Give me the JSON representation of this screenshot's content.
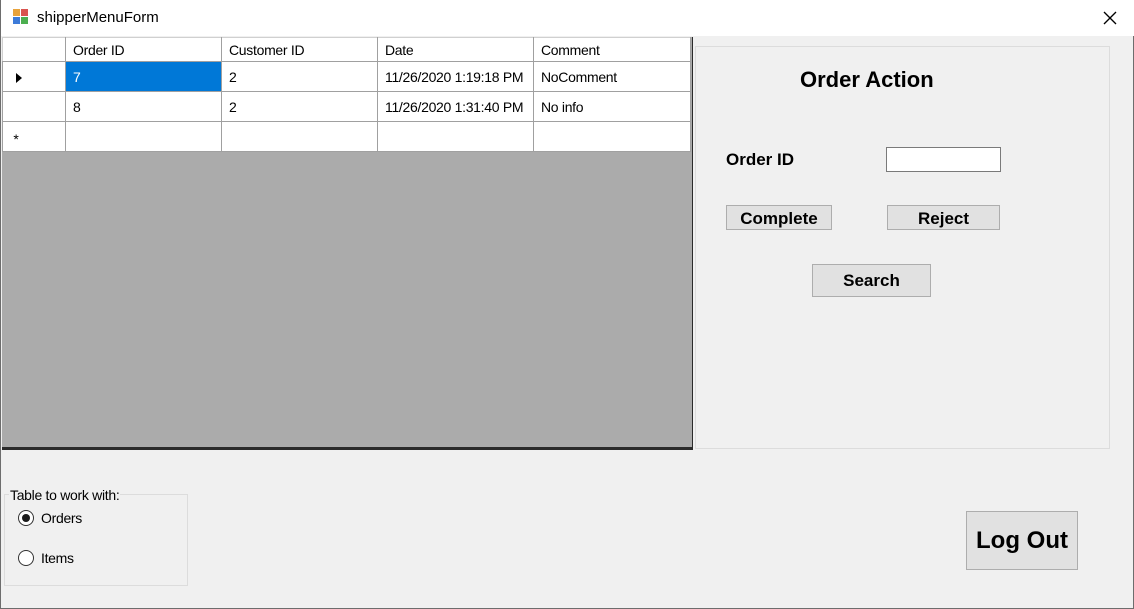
{
  "window": {
    "title": "shipperMenuForm",
    "close_glyph": "✕"
  },
  "grid": {
    "columns": [
      "Order ID",
      "Customer ID",
      "Date",
      "Comment"
    ],
    "rows": [
      {
        "order_id": "7",
        "customer_id": "2",
        "date": "11/26/2020 1:19:18 PM",
        "comment": "NoComment"
      },
      {
        "order_id": "8",
        "customer_id": "2",
        "date": "11/26/2020 1:31:40 PM",
        "comment": "No info"
      }
    ],
    "new_row_glyph": "*",
    "selection_color": "#0078d7"
  },
  "order_action": {
    "title": "Order Action",
    "order_id_label": "Order ID",
    "order_id_value": "",
    "complete_label": "Complete",
    "reject_label": "Reject",
    "search_label": "Search"
  },
  "table_select": {
    "legend": "Table to work with:",
    "options": [
      {
        "label": "Orders",
        "selected": true
      },
      {
        "label": "Items",
        "selected": false
      }
    ]
  },
  "logout_label": "Log Out"
}
